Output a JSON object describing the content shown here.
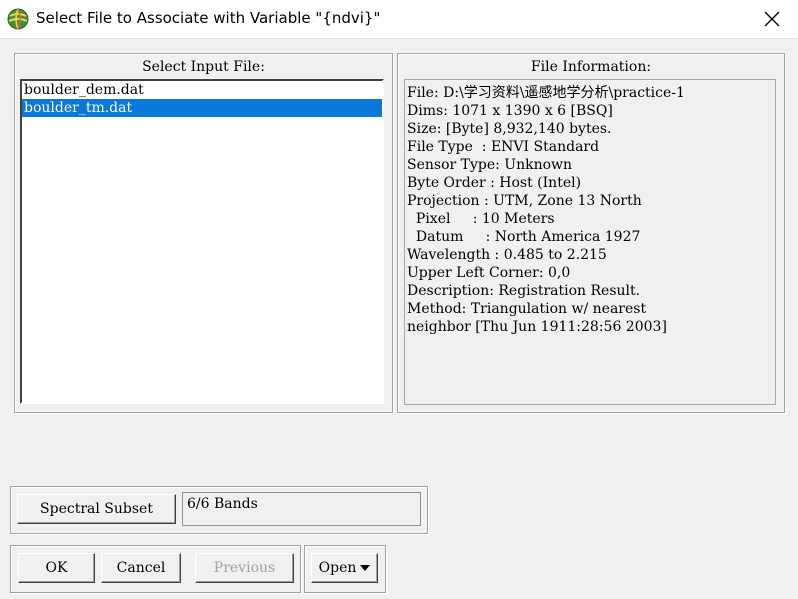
{
  "window": {
    "title": "Select File to Associate with Variable \"{ndvi}\""
  },
  "input_panel": {
    "label": "Select Input File:",
    "files": [
      {
        "name": "boulder_dem.dat",
        "selected": false
      },
      {
        "name": "boulder_tm.dat",
        "selected": true
      }
    ]
  },
  "info_panel": {
    "label": "File Information:",
    "lines": [
      "File: D:\\学习资料\\遥感地学分析\\practice-1",
      "Dims: 1071 x 1390 x 6 [BSQ]",
      "Size: [Byte] 8,932,140 bytes.",
      "File Type  : ENVI Standard",
      "Sensor Type: Unknown",
      "Byte Order : Host (Intel)",
      "Projection : UTM, Zone 13 North",
      "  Pixel     : 10 Meters",
      "  Datum     : North America 1927",
      "Wavelength : 0.485 to 2.215",
      "Upper Left Corner: 0,0",
      "Description: Registration Result.",
      "Method: Triangulation w/ nearest",
      "neighbor [Thu Jun 1911:28:56 2003]"
    ]
  },
  "subset": {
    "button_label": "Spectral Subset",
    "value": "6/6 Bands"
  },
  "buttons": {
    "ok": "OK",
    "cancel": "Cancel",
    "previous": "Previous",
    "open": "Open"
  },
  "colors": {
    "selection": "#0a78d7",
    "background": "#f0f0f0"
  }
}
